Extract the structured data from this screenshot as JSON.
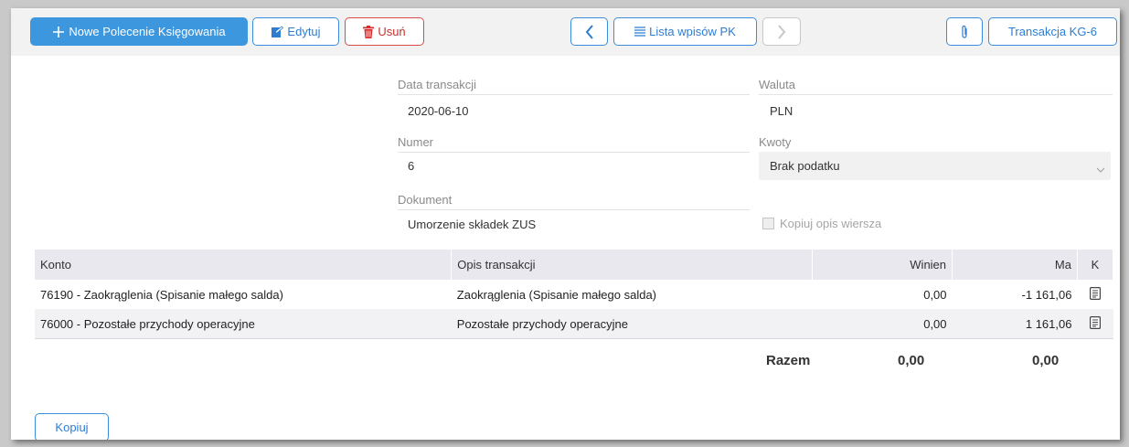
{
  "toolbar": {
    "new_label": "Nowe Polecenie Księgowania",
    "edit_label": "Edytuj",
    "delete_label": "Usuń",
    "list_label": "Lista wpisów PK",
    "transaction_label": "Transakcja KG-6"
  },
  "form": {
    "date_label": "Data transakcji",
    "date_value": "2020-06-10",
    "currency_label": "Waluta",
    "currency_value": "PLN",
    "number_label": "Numer",
    "number_value": "6",
    "amounts_label": "Kwoty",
    "amounts_value": "Brak podatku",
    "document_label": "Dokument",
    "document_value": "Umorzenie składek ZUS",
    "copy_desc_label": "Kopiuj opis wiersza",
    "copy_desc_checked": false
  },
  "table": {
    "columns": [
      "Konto",
      "Opis transakcji",
      "Winien",
      "Ma",
      "K"
    ],
    "rows": [
      {
        "account": "76190 - Zaokrąglenia (Spisanie małego salda)",
        "description": "Zaokrąglenia (Spisanie małego salda)",
        "debit": "0,00",
        "credit": "-1 161,06"
      },
      {
        "account": "76000 - Pozostałe przychody operacyjne",
        "description": "Pozostałe przychody operacyjne",
        "debit": "0,00",
        "credit": "1 161,06"
      }
    ]
  },
  "totals": {
    "label": "Razem",
    "debit": "0,00",
    "credit": "0,00"
  },
  "footer": {
    "copy_label": "Kopiuj"
  },
  "colors": {
    "accent": "#3c97de",
    "danger": "#d94b4b",
    "header_bg": "#e8e8ee"
  },
  "icons": [
    "plus-icon",
    "edit-icon",
    "trash-icon",
    "chevron-left-icon",
    "list-icon",
    "chevron-right-icon",
    "paperclip-icon",
    "select-chevron-icon",
    "document-icon"
  ]
}
